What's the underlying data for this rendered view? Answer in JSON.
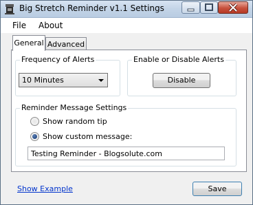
{
  "window": {
    "title": "Big Stretch Reminder v1.1 Settings",
    "icon": "app-icon"
  },
  "caption_buttons": [
    "minimize-icon",
    "maximize-icon",
    "close-icon"
  ],
  "menu": {
    "file": "File",
    "about": "About"
  },
  "tabs": {
    "general": "General",
    "advanced": "Advanced"
  },
  "frequency": {
    "legend": "Frequency of Alerts",
    "selected": "10 Minutes"
  },
  "alerts": {
    "legend": "Enable or Disable Alerts",
    "button": "Disable"
  },
  "message": {
    "legend": "Reminder Message Settings",
    "random_tip": "Show random tip",
    "custom": "Show custom message:",
    "custom_selected": true,
    "text": "Testing Reminder - Blogsolute.com"
  },
  "footer": {
    "link": "Show Example",
    "save": "Save"
  }
}
